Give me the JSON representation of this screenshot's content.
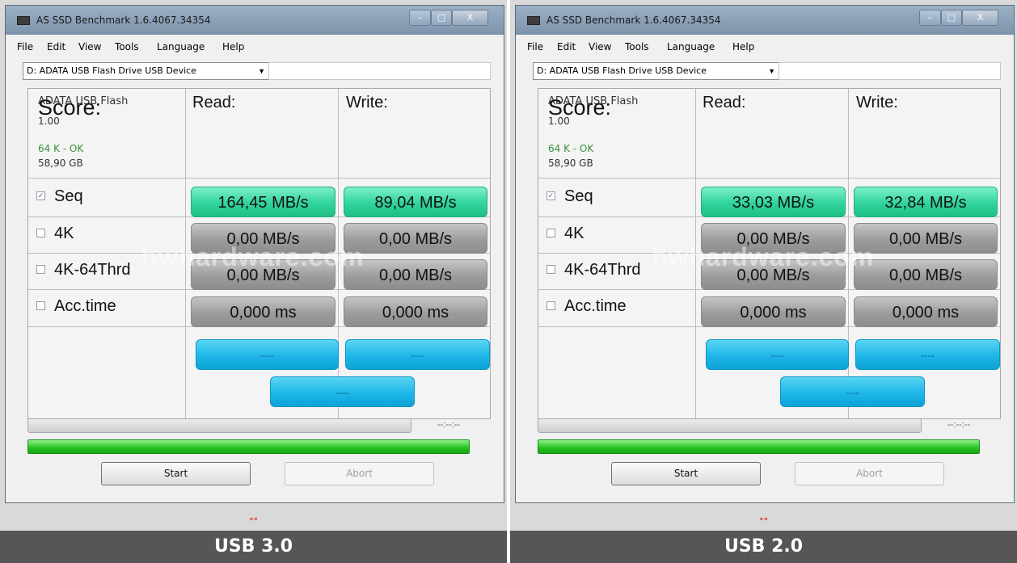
{
  "panels": [
    {
      "window_title": "AS SSD Benchmark 1.6.4067.34354",
      "menu": [
        "File",
        "Edit",
        "View",
        "Tools",
        "Language",
        "Help"
      ],
      "drive_select": "D: ADATA USB Flash Drive USB Device",
      "device": {
        "name": "ADATA USB Flash",
        "version": "1.00",
        "alignment": "64 K - OK",
        "size": "58,90 GB"
      },
      "headers": {
        "read": "Read:",
        "write": "Write:"
      },
      "rows": [
        {
          "label": "Seq",
          "checked": true,
          "read": "164,45 MB/s",
          "write": "89,04 MB/s"
        },
        {
          "label": "4K",
          "checked": false,
          "read": "0,00 MB/s",
          "write": "0,00 MB/s"
        },
        {
          "label": "4K-64Thrd",
          "checked": false,
          "read": "0,00 MB/s",
          "write": "0,00 MB/s"
        },
        {
          "label": "Acc.time",
          "checked": false,
          "read": "0,000 ms",
          "write": "0,000 ms"
        }
      ],
      "score_label": "Score:",
      "score": {
        "read": "----",
        "write": "----",
        "total": "----"
      },
      "elapsed": "--:--:--",
      "buttons": {
        "start": "Start",
        "abort": "Abort"
      },
      "watermark": "hwhardware.com",
      "arrow": "↔",
      "caption": "USB 3.0"
    },
    {
      "window_title": "AS SSD Benchmark 1.6.4067.34354",
      "menu": [
        "File",
        "Edit",
        "View",
        "Tools",
        "Language",
        "Help"
      ],
      "drive_select": "D: ADATA USB Flash Drive USB Device",
      "device": {
        "name": "ADATA USB Flash",
        "version": "1.00",
        "alignment": "64 K - OK",
        "size": "58,90 GB"
      },
      "headers": {
        "read": "Read:",
        "write": "Write:"
      },
      "rows": [
        {
          "label": "Seq",
          "checked": true,
          "read": "33,03 MB/s",
          "write": "32,84 MB/s"
        },
        {
          "label": "4K",
          "checked": false,
          "read": "0,00 MB/s",
          "write": "0,00 MB/s"
        },
        {
          "label": "4K-64Thrd",
          "checked": false,
          "read": "0,00 MB/s",
          "write": "0,00 MB/s"
        },
        {
          "label": "Acc.time",
          "checked": false,
          "read": "0,000 ms",
          "write": "0,000 ms"
        }
      ],
      "score_label": "Score:",
      "score": {
        "read": "----",
        "write": "----",
        "total": "----"
      },
      "elapsed": "--:--:--",
      "buttons": {
        "start": "Start",
        "abort": "Abort"
      },
      "watermark": "hwhardware.com",
      "arrow": "↔",
      "caption": "USB 2.0"
    }
  ],
  "window_controls": {
    "minimize": "–",
    "maximize": "□",
    "close": "X"
  },
  "colors": {
    "seq_pill": "#30d49a",
    "idle_pill": "#9c9c9c",
    "score_pill": "#1eb6e8",
    "progress_done": "#23c21f",
    "caption_bg": "#565656",
    "arrow": "#dd1111"
  }
}
